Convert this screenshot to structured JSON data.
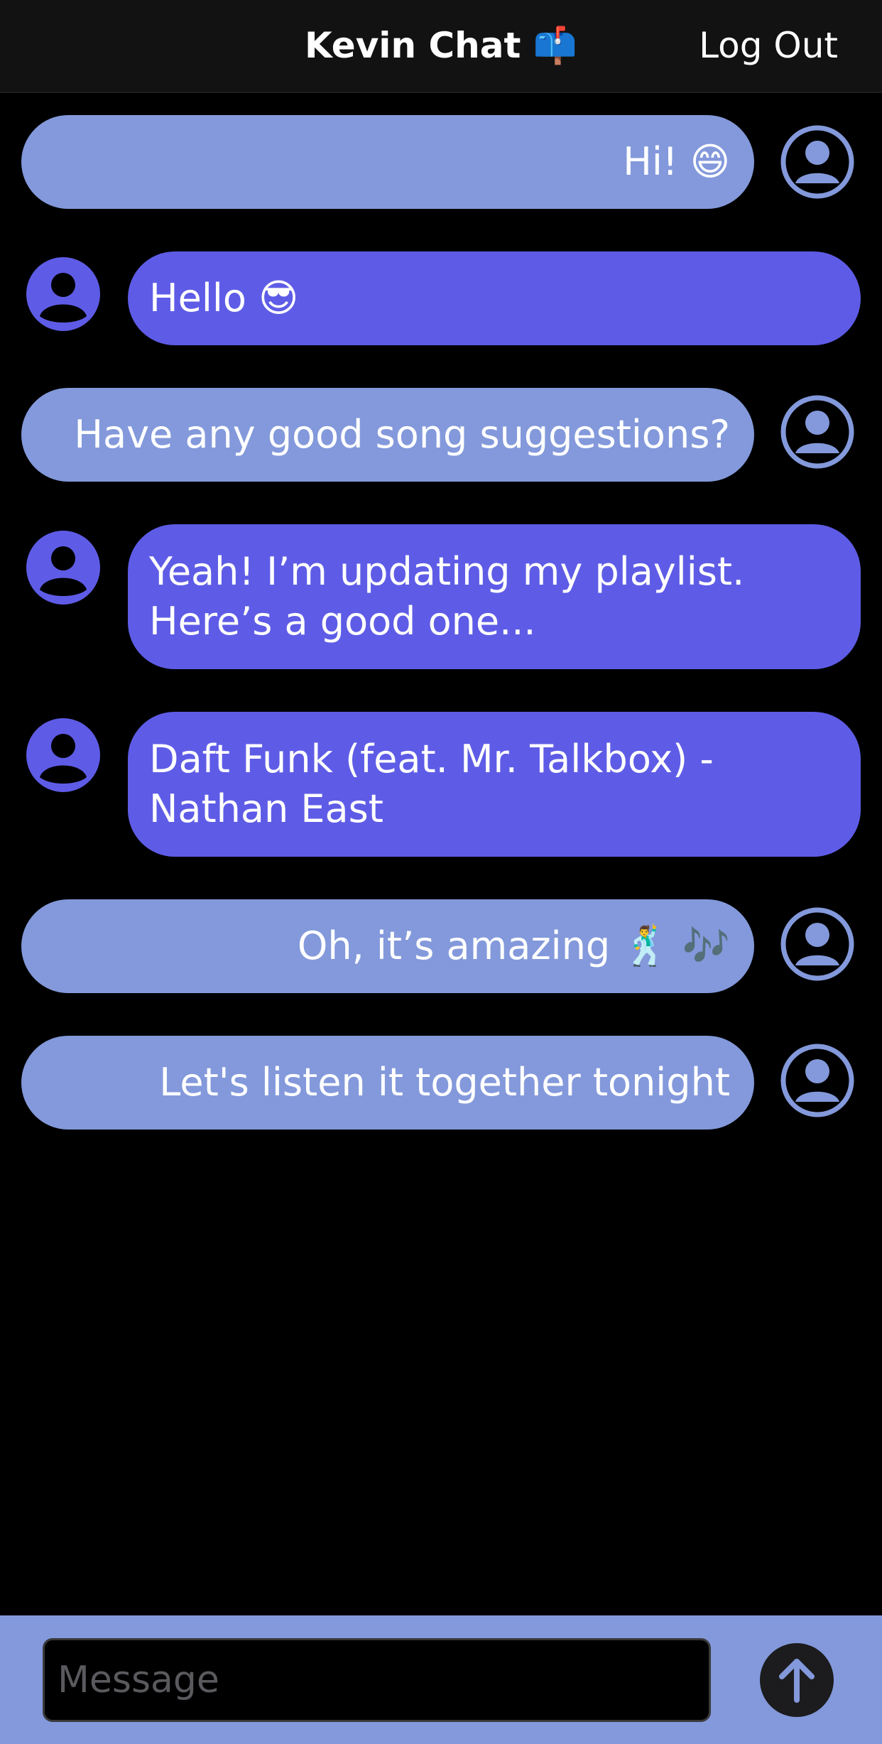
{
  "header": {
    "title": "Kevin Chat 📫",
    "logout_label": "Log Out"
  },
  "messages": [
    {
      "sender": "me",
      "text": "Hi! 😄"
    },
    {
      "sender": "them",
      "text": "Hello 😎"
    },
    {
      "sender": "me",
      "text": "Have any good song suggestions?"
    },
    {
      "sender": "them",
      "text": "Yeah! I’m updating my playlist. Here’s a good one..."
    },
    {
      "sender": "them",
      "text": "Daft Funk (feat. Mr. Talkbox) - Nathan East"
    },
    {
      "sender": "me",
      "text": "Oh, it’s amazing 🕺 🎶"
    },
    {
      "sender": "me",
      "text": "Let's listen it together tonight"
    }
  ],
  "composer": {
    "placeholder": "Message",
    "value": ""
  },
  "icons": {
    "avatar": "person-icon",
    "send": "arrow-up-icon"
  },
  "colors": {
    "background": "#000000",
    "header_bg": "#121212",
    "my_bubble": "#8399db",
    "their_bubble": "#5e5ce6",
    "composer_bg": "#8399db",
    "send_button": "#1c1c1e"
  }
}
